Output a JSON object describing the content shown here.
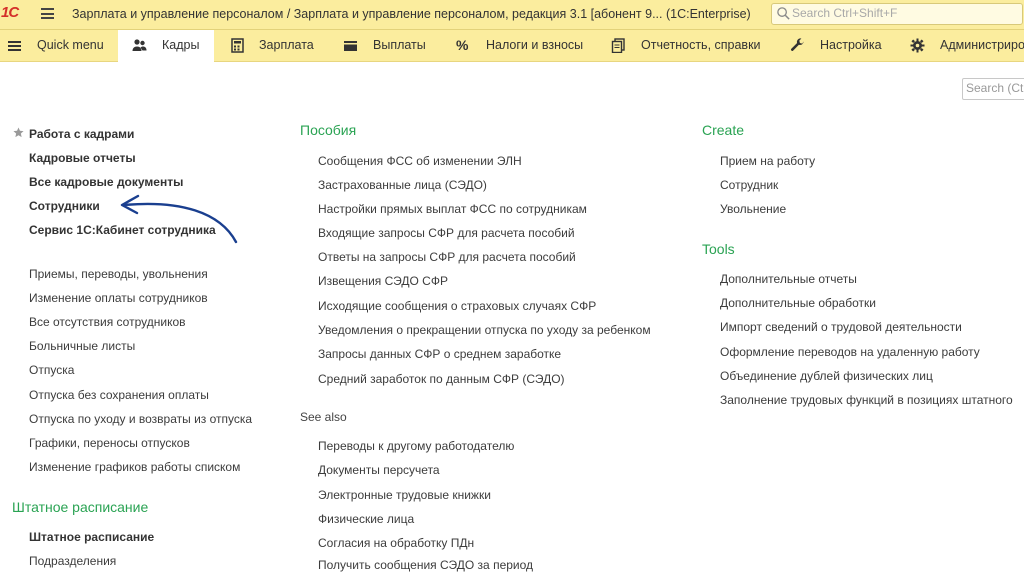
{
  "titlebar": {
    "logo": "1С",
    "title": "Зарплата и управление персоналом / Зарплата и управление персоналом, редакция 3.1 [абонент 9...   (1C:Enterprise)",
    "search_placeholder": "Search Ctrl+Shift+F"
  },
  "sections": [
    {
      "label": "Quick menu",
      "icon": "menu-icon"
    },
    {
      "label": "Кадры",
      "icon": "people-icon",
      "active": true
    },
    {
      "label": "Зарплата",
      "icon": "calculator-icon"
    },
    {
      "label": "Выплаты",
      "icon": "wallet-icon"
    },
    {
      "label": "Налоги и взносы",
      "icon": "percent-icon"
    },
    {
      "label": "Отчетность, справки",
      "icon": "documents-icon"
    },
    {
      "label": "Настройка",
      "icon": "wrench-icon"
    },
    {
      "label": "Администриро",
      "icon": "gear-icon"
    }
  ],
  "panel_search_placeholder": "Search (Ct",
  "left": {
    "favorites": [
      "Работа с кадрами",
      "Кадровые отчеты",
      "Все кадровые документы",
      "Сотрудники",
      "Сервис 1С:Кабинет сотрудника"
    ],
    "items": [
      "Приемы, переводы, увольнения",
      "Изменение оплаты сотрудников",
      "Все отсутствия сотрудников",
      "Больничные листы",
      "Отпуска",
      "Отпуска без сохранения оплаты",
      "Отпуска по уходу и возвраты из отпуска",
      "Графики, переносы отпусков",
      "Изменение графиков работы списком"
    ],
    "group2_title": "Штатное расписание",
    "group2_bold": "Штатное расписание",
    "group2_items": [
      "Подразделения"
    ]
  },
  "middle": {
    "group_title": "Пособия",
    "items": [
      "Сообщения ФСС об изменении ЭЛН",
      "Застрахованные лица (СЭДО)",
      "Настройки прямых выплат ФСС по сотрудникам",
      "Входящие запросы СФР для расчета пособий",
      "Ответы на запросы СФР для расчета пособий",
      "Извещения СЭДО СФР",
      "Исходящие сообщения о страховых случаях СФР",
      "Уведомления о прекращении отпуска по уходу за ребенком",
      "Запросы данных СФР о среднем заработке",
      "Средний заработок по данным СФР (СЭДО)"
    ],
    "see_also_title": "See also",
    "see_also": [
      "Переводы к другому работодателю",
      "Документы персучета",
      "Электронные трудовые книжки",
      "Физические лица",
      "Согласия на обработку ПДн",
      "Получить сообщения СЭДО за период"
    ]
  },
  "right": {
    "create_title": "Create",
    "create_items": [
      "Прием на работу",
      "Сотрудник",
      "Увольнение"
    ],
    "tools_title": "Tools",
    "tools_items": [
      "Дополнительные отчеты",
      "Дополнительные обработки",
      "Импорт сведений о трудовой деятельности",
      "Оформление переводов на удаленную работу",
      "Объединение дублей физических лиц",
      "Заполнение трудовых функций в позициях штатного"
    ]
  },
  "colors": {
    "bar": "#fbed9e",
    "group_title": "#2aa353",
    "arrow": "#1a3f8f",
    "logo_red": "#d4302a"
  }
}
